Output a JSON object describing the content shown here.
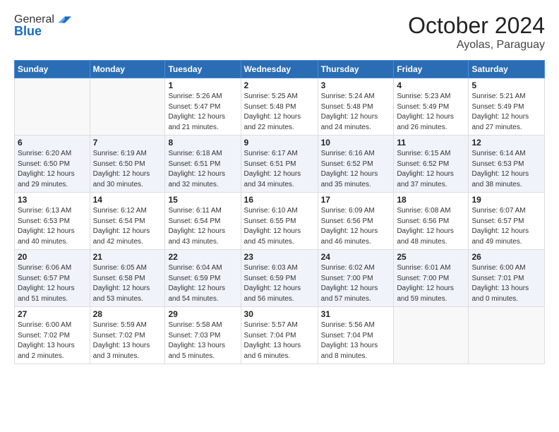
{
  "header": {
    "logo_line1": "General",
    "logo_line2": "Blue",
    "month": "October 2024",
    "location": "Ayolas, Paraguay"
  },
  "weekdays": [
    "Sunday",
    "Monday",
    "Tuesday",
    "Wednesday",
    "Thursday",
    "Friday",
    "Saturday"
  ],
  "weeks": [
    [
      {
        "day": "",
        "content": ""
      },
      {
        "day": "",
        "content": ""
      },
      {
        "day": "1",
        "content": "Sunrise: 5:26 AM\nSunset: 5:47 PM\nDaylight: 12 hours and 21 minutes."
      },
      {
        "day": "2",
        "content": "Sunrise: 5:25 AM\nSunset: 5:48 PM\nDaylight: 12 hours and 22 minutes."
      },
      {
        "day": "3",
        "content": "Sunrise: 5:24 AM\nSunset: 5:48 PM\nDaylight: 12 hours and 24 minutes."
      },
      {
        "day": "4",
        "content": "Sunrise: 5:23 AM\nSunset: 5:49 PM\nDaylight: 12 hours and 26 minutes."
      },
      {
        "day": "5",
        "content": "Sunrise: 5:21 AM\nSunset: 5:49 PM\nDaylight: 12 hours and 27 minutes."
      }
    ],
    [
      {
        "day": "6",
        "content": "Sunrise: 6:20 AM\nSunset: 6:50 PM\nDaylight: 12 hours and 29 minutes."
      },
      {
        "day": "7",
        "content": "Sunrise: 6:19 AM\nSunset: 6:50 PM\nDaylight: 12 hours and 30 minutes."
      },
      {
        "day": "8",
        "content": "Sunrise: 6:18 AM\nSunset: 6:51 PM\nDaylight: 12 hours and 32 minutes."
      },
      {
        "day": "9",
        "content": "Sunrise: 6:17 AM\nSunset: 6:51 PM\nDaylight: 12 hours and 34 minutes."
      },
      {
        "day": "10",
        "content": "Sunrise: 6:16 AM\nSunset: 6:52 PM\nDaylight: 12 hours and 35 minutes."
      },
      {
        "day": "11",
        "content": "Sunrise: 6:15 AM\nSunset: 6:52 PM\nDaylight: 12 hours and 37 minutes."
      },
      {
        "day": "12",
        "content": "Sunrise: 6:14 AM\nSunset: 6:53 PM\nDaylight: 12 hours and 38 minutes."
      }
    ],
    [
      {
        "day": "13",
        "content": "Sunrise: 6:13 AM\nSunset: 6:53 PM\nDaylight: 12 hours and 40 minutes."
      },
      {
        "day": "14",
        "content": "Sunrise: 6:12 AM\nSunset: 6:54 PM\nDaylight: 12 hours and 42 minutes."
      },
      {
        "day": "15",
        "content": "Sunrise: 6:11 AM\nSunset: 6:54 PM\nDaylight: 12 hours and 43 minutes."
      },
      {
        "day": "16",
        "content": "Sunrise: 6:10 AM\nSunset: 6:55 PM\nDaylight: 12 hours and 45 minutes."
      },
      {
        "day": "17",
        "content": "Sunrise: 6:09 AM\nSunset: 6:56 PM\nDaylight: 12 hours and 46 minutes."
      },
      {
        "day": "18",
        "content": "Sunrise: 6:08 AM\nSunset: 6:56 PM\nDaylight: 12 hours and 48 minutes."
      },
      {
        "day": "19",
        "content": "Sunrise: 6:07 AM\nSunset: 6:57 PM\nDaylight: 12 hours and 49 minutes."
      }
    ],
    [
      {
        "day": "20",
        "content": "Sunrise: 6:06 AM\nSunset: 6:57 PM\nDaylight: 12 hours and 51 minutes."
      },
      {
        "day": "21",
        "content": "Sunrise: 6:05 AM\nSunset: 6:58 PM\nDaylight: 12 hours and 53 minutes."
      },
      {
        "day": "22",
        "content": "Sunrise: 6:04 AM\nSunset: 6:59 PM\nDaylight: 12 hours and 54 minutes."
      },
      {
        "day": "23",
        "content": "Sunrise: 6:03 AM\nSunset: 6:59 PM\nDaylight: 12 hours and 56 minutes."
      },
      {
        "day": "24",
        "content": "Sunrise: 6:02 AM\nSunset: 7:00 PM\nDaylight: 12 hours and 57 minutes."
      },
      {
        "day": "25",
        "content": "Sunrise: 6:01 AM\nSunset: 7:00 PM\nDaylight: 12 hours and 59 minutes."
      },
      {
        "day": "26",
        "content": "Sunrise: 6:00 AM\nSunset: 7:01 PM\nDaylight: 13 hours and 0 minutes."
      }
    ],
    [
      {
        "day": "27",
        "content": "Sunrise: 6:00 AM\nSunset: 7:02 PM\nDaylight: 13 hours and 2 minutes."
      },
      {
        "day": "28",
        "content": "Sunrise: 5:59 AM\nSunset: 7:02 PM\nDaylight: 13 hours and 3 minutes."
      },
      {
        "day": "29",
        "content": "Sunrise: 5:58 AM\nSunset: 7:03 PM\nDaylight: 13 hours and 5 minutes."
      },
      {
        "day": "30",
        "content": "Sunrise: 5:57 AM\nSunset: 7:04 PM\nDaylight: 13 hours and 6 minutes."
      },
      {
        "day": "31",
        "content": "Sunrise: 5:56 AM\nSunset: 7:04 PM\nDaylight: 13 hours and 8 minutes."
      },
      {
        "day": "",
        "content": ""
      },
      {
        "day": "",
        "content": ""
      }
    ]
  ]
}
